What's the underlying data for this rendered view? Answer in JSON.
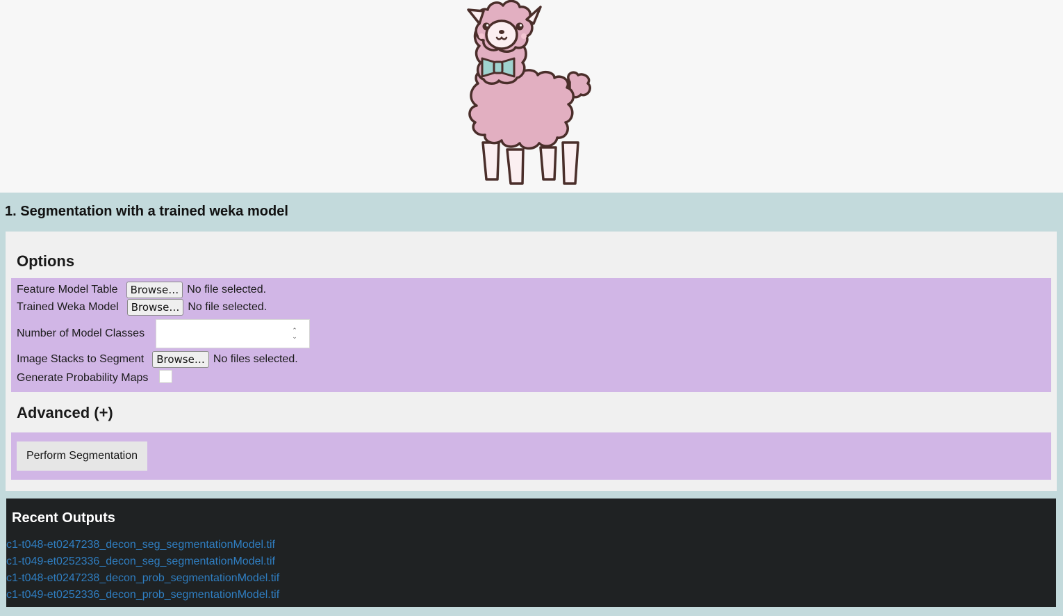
{
  "section": {
    "title": "1. Segmentation with a trained weka model"
  },
  "options": {
    "title": "Options",
    "feature_model_table": {
      "label": "Feature Model Table",
      "button": "Browse…",
      "status": "No file selected."
    },
    "trained_weka_model": {
      "label": "Trained Weka Model",
      "button": "Browse…",
      "status": "No file selected."
    },
    "number_of_model_classes": {
      "label": "Number of Model Classes",
      "value": ""
    },
    "image_stacks": {
      "label": "Image Stacks to Segment",
      "button": "Browse…",
      "status": "No files selected."
    },
    "probability_maps": {
      "label": "Generate Probability Maps",
      "checked": false
    }
  },
  "advanced": {
    "title": "Advanced (+)"
  },
  "actions": {
    "perform_label": "Perform Segmentation"
  },
  "recent_outputs": {
    "title": "Recent Outputs",
    "files": [
      "c1-t048-et0247238_decon_seg_segmentationModel.tif",
      "c1-t049-et0252336_decon_seg_segmentationModel.tif",
      "c1-t048-et0247238_decon_prob_segmentationModel.tif",
      "c1-t049-et0252336_decon_prob_segmentationModel.tif"
    ]
  },
  "colors": {
    "header_bg": "#f7f7f7",
    "section_bg": "#c3dadc",
    "panel_purple": "#d1b6e6",
    "outputs_bg": "#1f2223",
    "link": "#2f7ec1",
    "llama_pink": "#e2afc1",
    "bowtie": "#9fd3cf"
  },
  "icons": {
    "mascot": "llama-mascot-icon"
  }
}
